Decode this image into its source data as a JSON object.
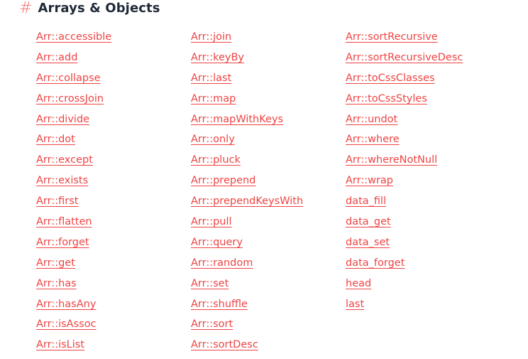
{
  "section": {
    "hash": "#",
    "title": "Arrays & Objects"
  },
  "columns": [
    [
      "Arr::accessible",
      "Arr::add",
      "Arr::collapse",
      "Arr::crossJoin",
      "Arr::divide",
      "Arr::dot",
      "Arr::except",
      "Arr::exists",
      "Arr::first",
      "Arr::flatten",
      "Arr::forget",
      "Arr::get",
      "Arr::has",
      "Arr::hasAny",
      "Arr::isAssoc",
      "Arr::isList"
    ],
    [
      "Arr::join",
      "Arr::keyBy",
      "Arr::last",
      "Arr::map",
      "Arr::mapWithKeys",
      "Arr::only",
      "Arr::pluck",
      "Arr::prepend",
      "Arr::prependKeysWith",
      "Arr::pull",
      "Arr::query",
      "Arr::random",
      "Arr::set",
      "Arr::shuffle",
      "Arr::sort",
      "Arr::sortDesc"
    ],
    [
      "Arr::sortRecursive",
      "Arr::sortRecursiveDesc",
      "Arr::toCssClasses",
      "Arr::toCssStyles",
      "Arr::undot",
      "Arr::where",
      "Arr::whereNotNull",
      "Arr::wrap",
      "data_fill",
      "data_get",
      "data_set",
      "data_forget",
      "head",
      "last"
    ]
  ],
  "colors": {
    "link": "#ef4444",
    "hash": "#f87171",
    "title": "#1f2937"
  }
}
